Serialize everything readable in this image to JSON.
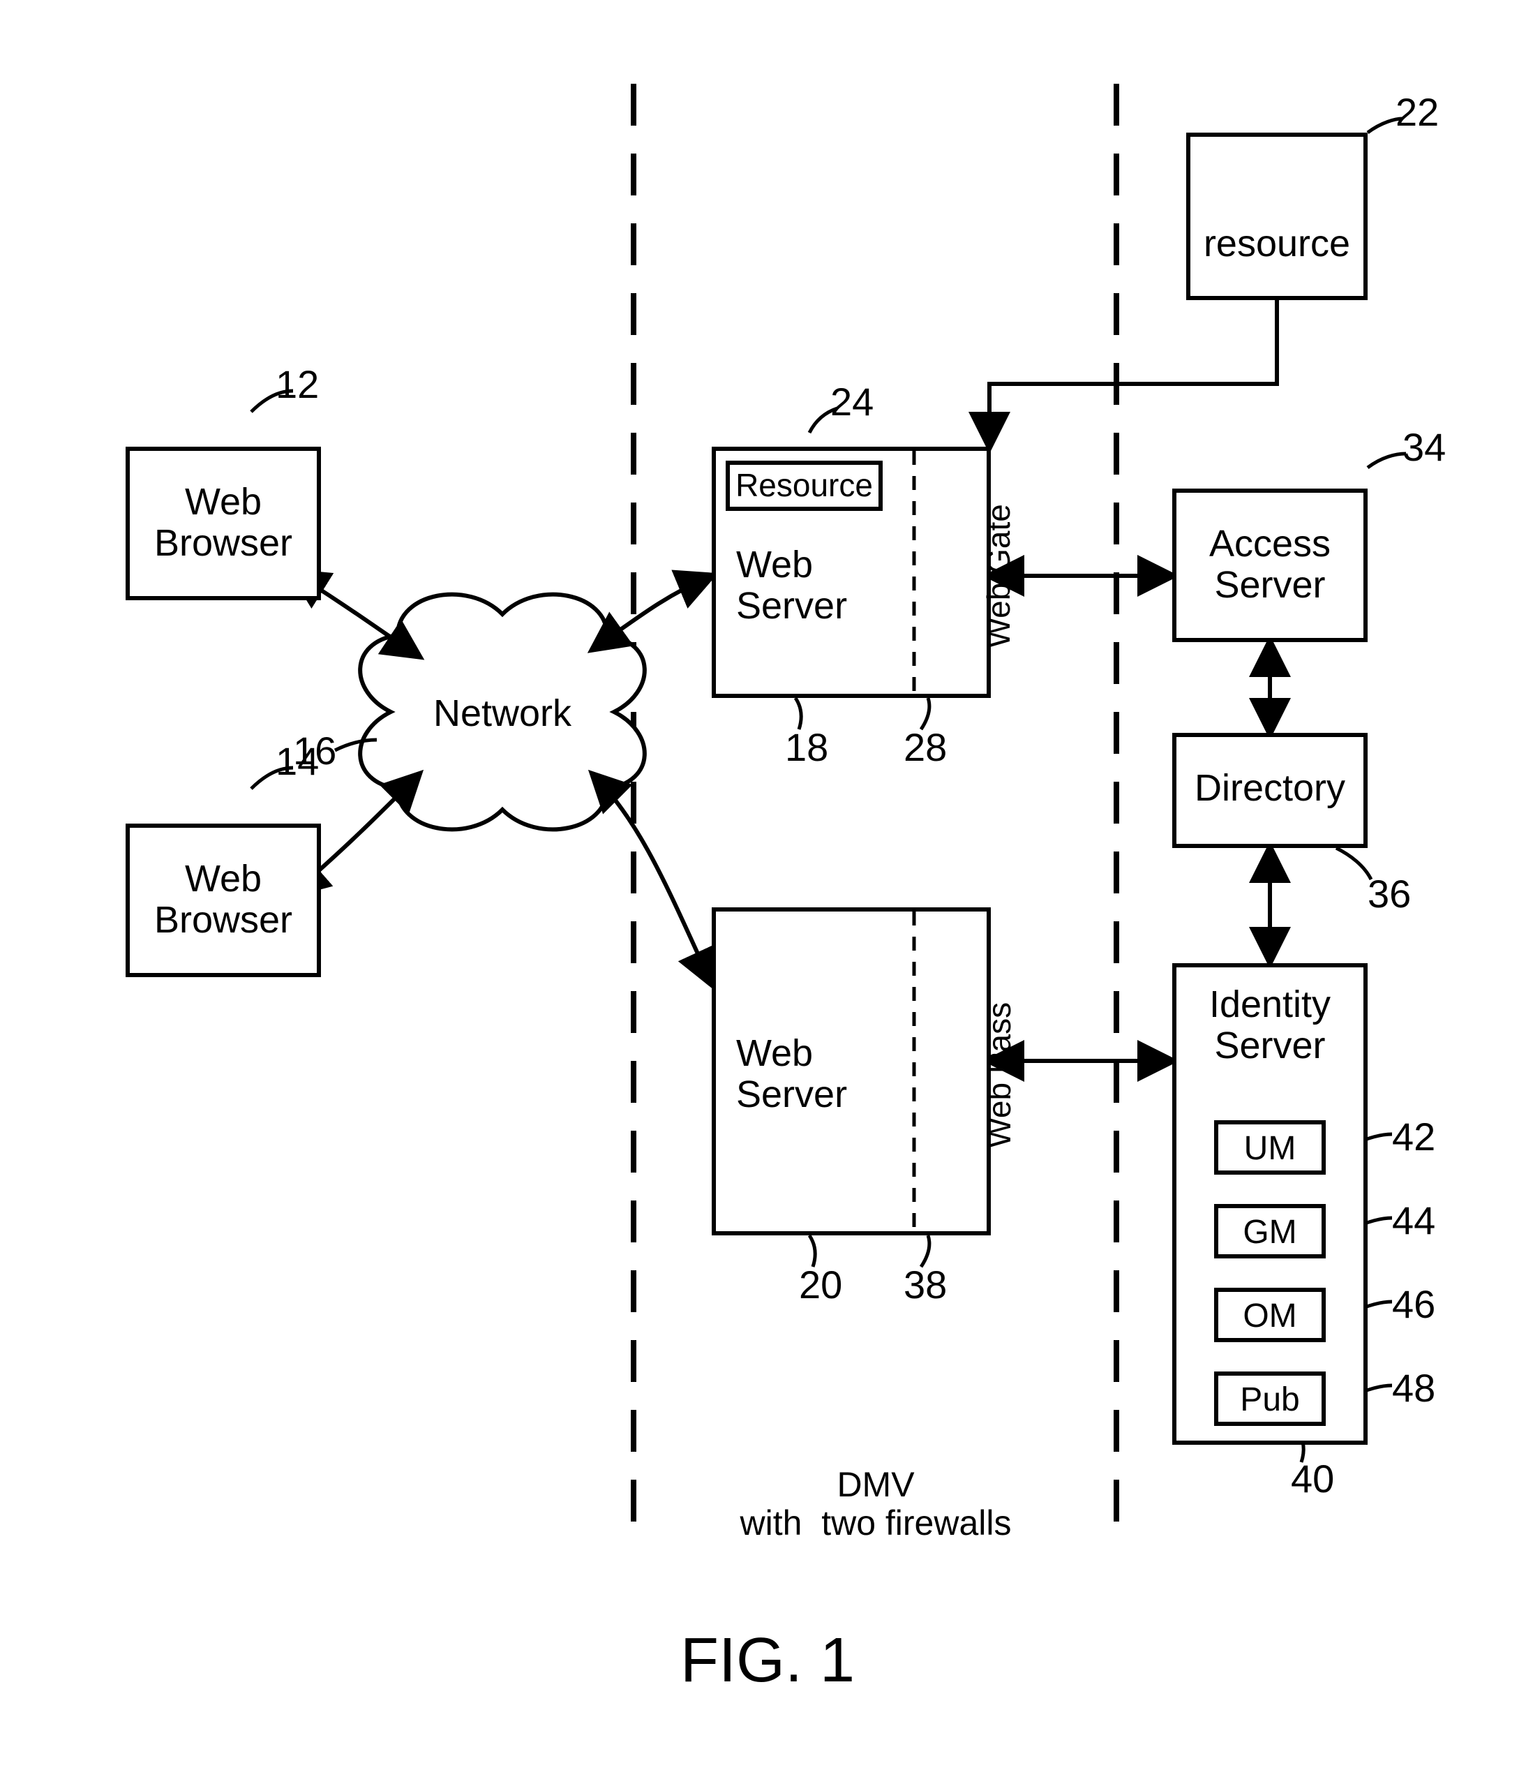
{
  "figure_label": "FIG. 1",
  "caption": "DMV\nwith  two firewalls",
  "nodes": {
    "browser1": {
      "text": "Web\nBrowser",
      "ref": "12"
    },
    "browser2": {
      "text": "Web\nBrowser",
      "ref": "14"
    },
    "network": {
      "text": "Network",
      "ref": "16"
    },
    "webserver1": {
      "text": "Web\nServer",
      "ref": "18"
    },
    "webserver2": {
      "text": "Web\nServer",
      "ref": "20"
    },
    "resource_outer": {
      "text": "resource",
      "ref": "22"
    },
    "resource_inner": {
      "text": "Resource",
      "ref": "24"
    },
    "webgate": {
      "text": "Web Gate",
      "ref": "28"
    },
    "webpass": {
      "text": "Web Pass",
      "ref": "38"
    },
    "access": {
      "text": "Access\nServer",
      "ref": "34"
    },
    "directory": {
      "text": "Directory",
      "ref": "36"
    },
    "identity": {
      "text": "Identity\nServer",
      "ref": "40"
    },
    "um": {
      "text": "UM",
      "ref": "42"
    },
    "gm": {
      "text": "GM",
      "ref": "44"
    },
    "om": {
      "text": "OM",
      "ref": "46"
    },
    "pub": {
      "text": "Pub",
      "ref": "48"
    }
  }
}
